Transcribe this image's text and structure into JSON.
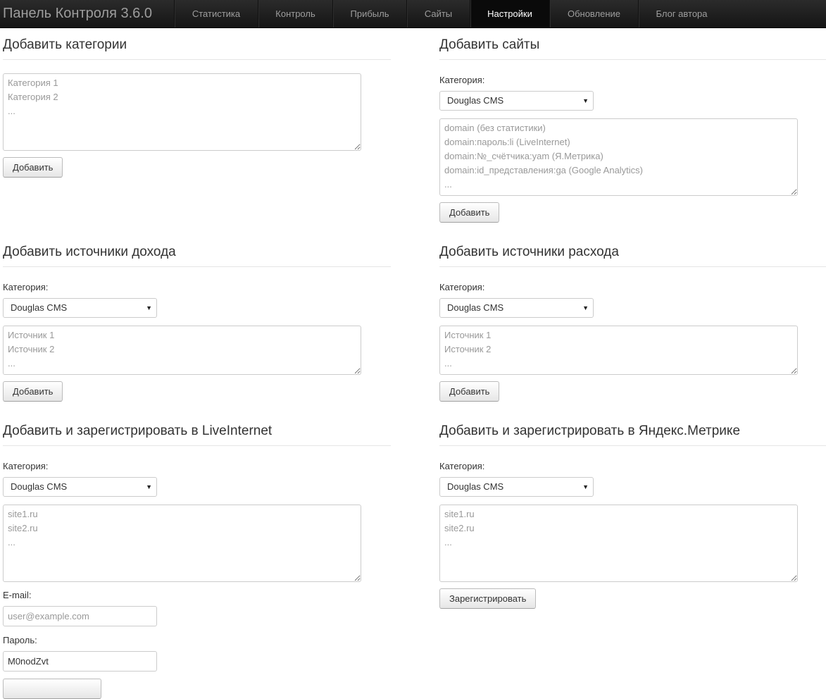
{
  "navbar": {
    "brand": "Панель Контроля 3.6.0",
    "items": [
      {
        "label": "Статистика"
      },
      {
        "label": "Контроль"
      },
      {
        "label": "Прибыль"
      },
      {
        "label": "Сайты"
      },
      {
        "label": "Настройки"
      },
      {
        "label": "Обновление"
      },
      {
        "label": "Блог автора"
      }
    ],
    "active": "Настройки"
  },
  "common": {
    "category_label": "Категория:",
    "category_selected": "Douglas CMS",
    "add_button": "Добавить"
  },
  "add_categories": {
    "title": "Добавить категории",
    "placeholder": "Категория 1\nКатегория 2\n...",
    "button": "Добавить"
  },
  "add_sites": {
    "title": "Добавить сайты",
    "placeholder": "domain (без статистики)\ndomain:пароль:li (LiveInternet)\ndomain:№_счётчика:yam (Я.Метрика)\ndomain:id_представления:ga (Google Analytics)\n...",
    "button": "Добавить"
  },
  "income_sources": {
    "title": "Добавить источники дохода",
    "placeholder": "Источник 1\nИсточник 2\n...",
    "button": "Добавить"
  },
  "expense_sources": {
    "title": "Добавить источники расхода",
    "placeholder": "Источник 1\nИсточник 2\n...",
    "button": "Добавить"
  },
  "liveinternet": {
    "title": "Добавить и зарегистрировать в LiveInternet",
    "placeholder": "site1.ru\nsite2.ru\n...",
    "email_label": "E-mail:",
    "email_placeholder": "user@example.com",
    "password_label": "Пароль:",
    "password_value": "M0nodZvt"
  },
  "yandex_metrika": {
    "title": "Добавить и зарегистрировать в Яндекс.Метрике",
    "placeholder": "site1.ru\nsite2.ru\n...",
    "button": "Зарегистрировать"
  },
  "icons": {
    "select_caret": "▼"
  }
}
